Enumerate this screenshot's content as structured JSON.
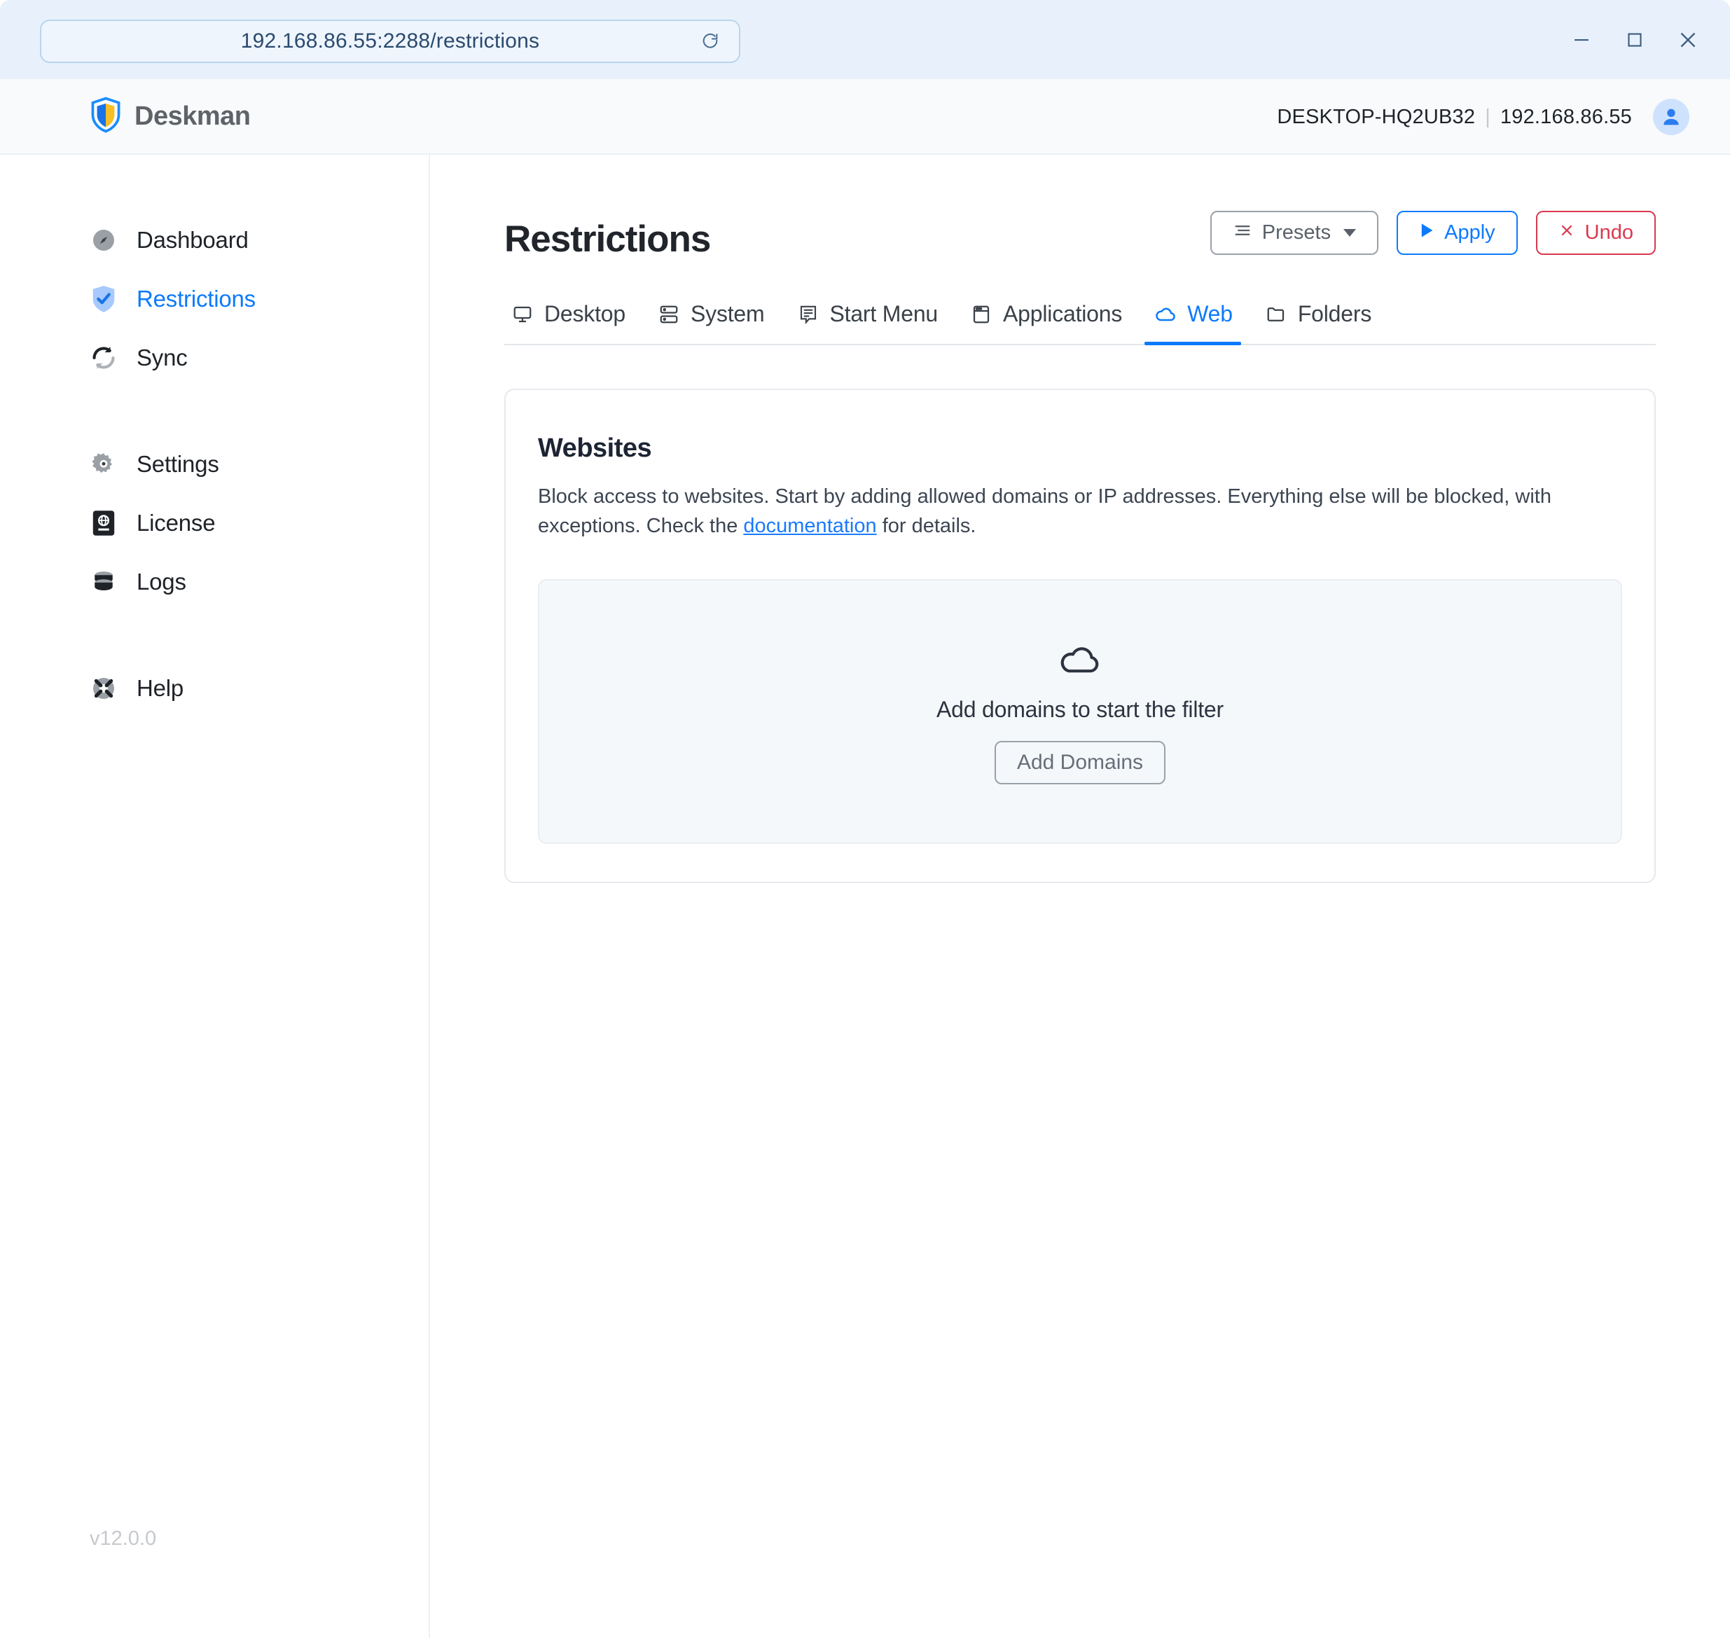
{
  "window": {
    "url": "192.168.86.55:2288/restrictions",
    "reload_icon": "reload-icon",
    "controls": [
      {
        "name": "minimize-button",
        "glyph": "minimize-icon"
      },
      {
        "name": "maximize-button",
        "glyph": "maximize-icon"
      },
      {
        "name": "close-button",
        "glyph": "close-icon"
      }
    ]
  },
  "header": {
    "brand": "Deskman",
    "brand_icon": "shield-logo-icon",
    "host_name": "DESKTOP-HQ2UB32",
    "separator": "|",
    "host_ip": "192.168.86.55",
    "avatar_icon": "user-avatar-icon"
  },
  "sidebar": {
    "items": [
      {
        "label": "Dashboard",
        "icon": "compass-icon",
        "active": false
      },
      {
        "label": "Restrictions",
        "icon": "shield-check-icon",
        "active": true
      },
      {
        "label": "Sync",
        "icon": "sync-arrows-icon",
        "active": false
      },
      {
        "label": "Settings",
        "icon": "gear-icon",
        "active": false
      },
      {
        "label": "License",
        "icon": "passport-icon",
        "active": false
      },
      {
        "label": "Logs",
        "icon": "database-icon",
        "active": false
      },
      {
        "label": "Help",
        "icon": "lifebuoy-icon",
        "active": false
      }
    ],
    "version": "v12.0.0"
  },
  "main": {
    "title": "Restrictions",
    "buttons": {
      "presets": "Presets",
      "apply": "Apply",
      "undo": "Undo"
    },
    "tabs": [
      {
        "label": "Desktop",
        "icon": "monitor-icon",
        "active": false
      },
      {
        "label": "System",
        "icon": "server-stack-icon",
        "active": false
      },
      {
        "label": "Start Menu",
        "icon": "menu-list-icon",
        "active": false
      },
      {
        "label": "Applications",
        "icon": "app-window-icon",
        "active": false
      },
      {
        "label": "Web",
        "icon": "cloud-icon",
        "active": true
      },
      {
        "label": "Folders",
        "icon": "folder-icon",
        "active": false
      }
    ],
    "card": {
      "title": "Websites",
      "desc_before": "Block access to websites. Start by adding allowed domains or IP addresses. Everything else will be blocked, with exceptions. Check the ",
      "desc_link": "documentation",
      "desc_after": " for details.",
      "empty": {
        "icon": "cloud-icon",
        "text": "Add domains to start the filter",
        "button": "Add Domains"
      }
    }
  },
  "colors": {
    "accent": "#0d7afc",
    "danger": "#d9394f",
    "titlebar_bg": "#e8f1fb",
    "panel_bg": "#f4f8fb"
  }
}
